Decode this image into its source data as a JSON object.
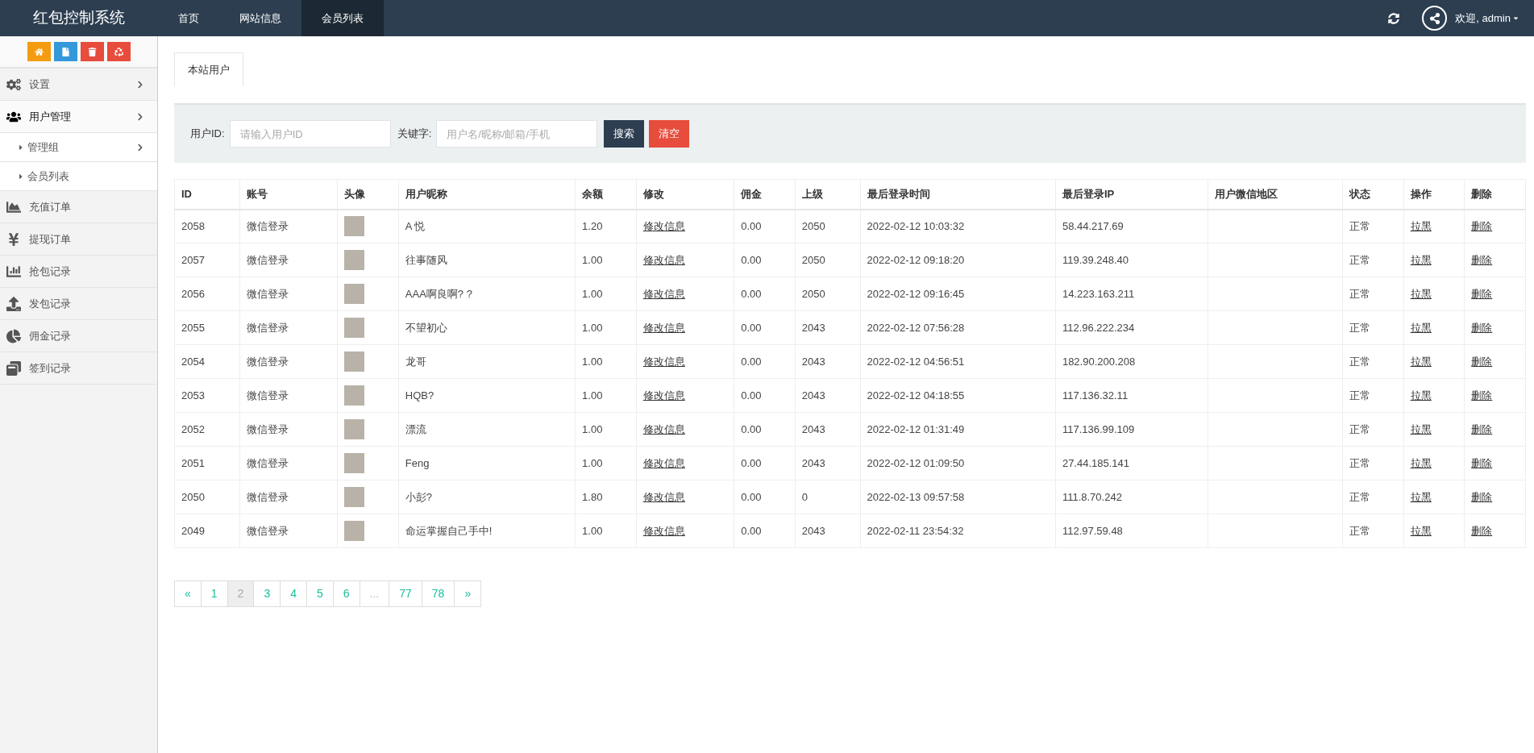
{
  "header": {
    "logo": "红包控制系统",
    "nav": [
      {
        "label": "首页",
        "selected": false
      },
      {
        "label": "网站信息",
        "selected": false
      },
      {
        "label": "会员列表",
        "selected": true
      }
    ],
    "user": "欢迎, admin"
  },
  "sidebar": {
    "tools": [
      {
        "color": "#f39c12"
      },
      {
        "color": "#3498db"
      },
      {
        "color": "#e74c3c"
      },
      {
        "color": "#e74c3c"
      }
    ],
    "items": [
      {
        "label": "设置",
        "kind": "group",
        "expanded": false
      },
      {
        "label": "用户管理",
        "kind": "group",
        "expanded": true,
        "children": [
          {
            "label": "管理组",
            "kind": "group"
          },
          {
            "label": "会员列表",
            "kind": "link"
          }
        ]
      },
      {
        "label": "充值订单",
        "kind": "link"
      },
      {
        "label": "提现订单",
        "kind": "link"
      },
      {
        "label": "抢包记录",
        "kind": "link"
      },
      {
        "label": "发包记录",
        "kind": "link"
      },
      {
        "label": "佣金记录",
        "kind": "link"
      },
      {
        "label": "签到记录",
        "kind": "link"
      }
    ]
  },
  "tabs": [
    {
      "label": "本站用户",
      "selected": true
    }
  ],
  "search": {
    "fields": [
      {
        "label": "用户ID:",
        "placeholder": "请输入用户ID"
      },
      {
        "label": "关键字:",
        "placeholder": "用户名/昵称/邮箱/手机"
      }
    ],
    "buttons": [
      {
        "label": "搜索",
        "kind": "primary"
      },
      {
        "label": "清空",
        "kind": "danger"
      }
    ]
  },
  "table": {
    "columns": [
      {
        "label": "ID",
        "kind": "text"
      },
      {
        "label": "账号",
        "kind": "text"
      },
      {
        "label": "头像",
        "kind": "avatar"
      },
      {
        "label": "用户昵称",
        "kind": "text"
      },
      {
        "label": "余额",
        "kind": "text"
      },
      {
        "label": "修改",
        "kind": "link"
      },
      {
        "label": "佣金",
        "kind": "text"
      },
      {
        "label": "上级",
        "kind": "text"
      },
      {
        "label": "最后登录时间",
        "kind": "text"
      },
      {
        "label": "最后登录IP",
        "kind": "text"
      },
      {
        "label": "用户微信地区",
        "kind": "blank"
      },
      {
        "label": "状态",
        "kind": "text"
      },
      {
        "label": "操作",
        "kind": "link"
      },
      {
        "label": "删除",
        "kind": "link"
      }
    ],
    "rows": [
      [
        "2058",
        "微信登录",
        "",
        "A 悦",
        "1.20",
        "修改信息",
        "0.00",
        "2050",
        "2022-02-12 10:03:32",
        "58.44.217.69",
        "",
        "正常",
        "拉黑",
        "删除"
      ],
      [
        "2057",
        "微信登录",
        "",
        "往事随风",
        "1.00",
        "修改信息",
        "0.00",
        "2050",
        "2022-02-12 09:18:20",
        "119.39.248.40",
        "",
        "正常",
        "拉黑",
        "删除"
      ],
      [
        "2056",
        "微信登录",
        "",
        "AAA啊良啊? ?",
        "1.00",
        "修改信息",
        "0.00",
        "2050",
        "2022-02-12 09:16:45",
        "14.223.163.211",
        "",
        "正常",
        "拉黑",
        "删除"
      ],
      [
        "2055",
        "微信登录",
        "",
        "不望初心",
        "1.00",
        "修改信息",
        "0.00",
        "2043",
        "2022-02-12 07:56:28",
        "112.96.222.234",
        "",
        "正常",
        "拉黑",
        "删除"
      ],
      [
        "2054",
        "微信登录",
        "",
        "龙哥",
        "1.00",
        "修改信息",
        "0.00",
        "2043",
        "2022-02-12 04:56:51",
        "182.90.200.208",
        "",
        "正常",
        "拉黑",
        "删除"
      ],
      [
        "2053",
        "微信登录",
        "",
        "HQB?",
        "1.00",
        "修改信息",
        "0.00",
        "2043",
        "2022-02-12 04:18:55",
        "117.136.32.11",
        "",
        "正常",
        "拉黑",
        "删除"
      ],
      [
        "2052",
        "微信登录",
        "",
        "漂流",
        "1.00",
        "修改信息",
        "0.00",
        "2043",
        "2022-02-12 01:31:49",
        "117.136.99.109",
        "",
        "正常",
        "拉黑",
        "删除"
      ],
      [
        "2051",
        "微信登录",
        "",
        "Feng",
        "1.00",
        "修改信息",
        "0.00",
        "2043",
        "2022-02-12 01:09:50",
        "27.44.185.141",
        "",
        "正常",
        "拉黑",
        "删除"
      ],
      [
        "2050",
        "微信登录",
        "",
        "小彭?",
        "1.80",
        "修改信息",
        "0.00",
        "0",
        "2022-02-13 09:57:58",
        "111.8.70.242",
        "",
        "正常",
        "拉黑",
        "删除"
      ],
      [
        "2049",
        "微信登录",
        "",
        "命运掌握自己手中!",
        "1.00",
        "修改信息",
        "0.00",
        "2043",
        "2022-02-11 23:54:32",
        "112.97.59.48",
        "",
        "正常",
        "拉黑",
        "删除"
      ]
    ]
  },
  "pagination": [
    {
      "label": "«",
      "selected": false,
      "disabled": false
    },
    {
      "label": "1",
      "selected": false,
      "disabled": false
    },
    {
      "label": "2",
      "selected": true,
      "disabled": false
    },
    {
      "label": "3",
      "selected": false,
      "disabled": false
    },
    {
      "label": "4",
      "selected": false,
      "disabled": false
    },
    {
      "label": "5",
      "selected": false,
      "disabled": false
    },
    {
      "label": "6",
      "selected": false,
      "disabled": false
    },
    {
      "label": "...",
      "selected": false,
      "disabled": true
    },
    {
      "label": "77",
      "selected": false,
      "disabled": false
    },
    {
      "label": "78",
      "selected": false,
      "disabled": false
    },
    {
      "label": "»",
      "selected": false,
      "disabled": false
    }
  ]
}
